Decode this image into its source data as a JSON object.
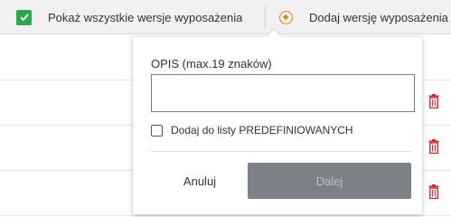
{
  "toolbar": {
    "show_all_label": "Pokaż wszystkie wersje wyposażenia",
    "show_all_checked": true,
    "add_version_label": "Dodaj wersję wyposażenia"
  },
  "dialog": {
    "field_label": "OPIS (max.19 znaków)",
    "field_value": "",
    "predefined_label": "Dodaj do listy PREDEFINIOWANYCH",
    "predefined_checked": false,
    "cancel_label": "Anuluj",
    "next_label": "Dalej"
  },
  "colors": {
    "check_green": "#2ea84a",
    "add_orange": "#ee7a14",
    "trash_red": "#d0282e",
    "next_button_disabled": "#7b8187"
  },
  "icons": [
    "checkbox-checked-icon",
    "plus-circle-icon",
    "trash-icon"
  ]
}
